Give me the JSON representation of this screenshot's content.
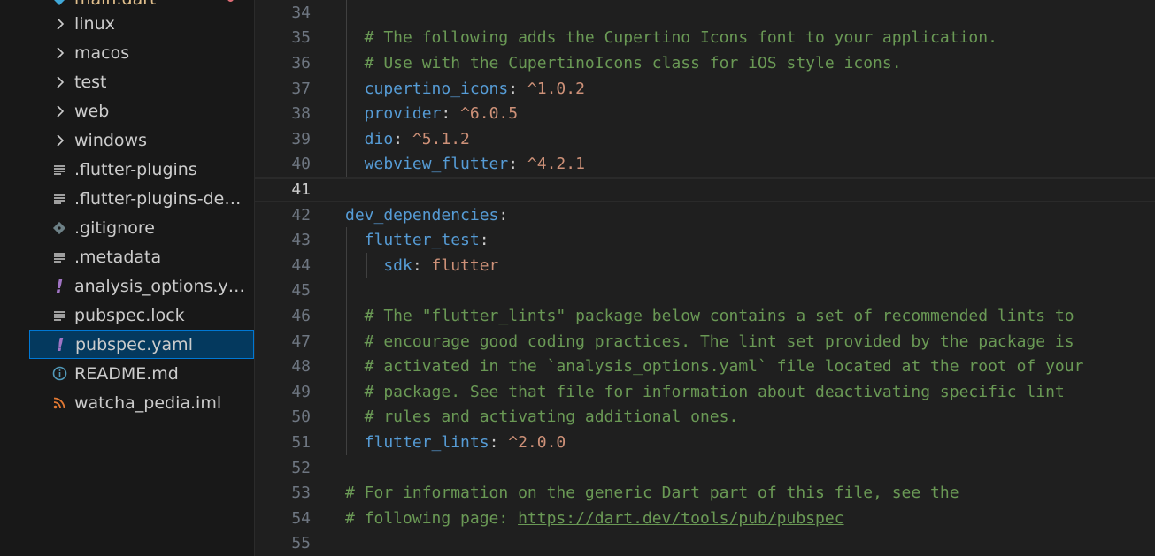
{
  "explorer": {
    "partial_top_label": "main.dart",
    "items": [
      {
        "label": "linux",
        "kind": "folder",
        "icon": "chevron-right-icon"
      },
      {
        "label": "macos",
        "kind": "folder",
        "icon": "chevron-right-icon"
      },
      {
        "label": "test",
        "kind": "folder",
        "icon": "chevron-right-icon"
      },
      {
        "label": "web",
        "kind": "folder",
        "icon": "chevron-right-icon"
      },
      {
        "label": "windows",
        "kind": "folder",
        "icon": "chevron-right-icon"
      },
      {
        "label": ".flutter-plugins",
        "kind": "file",
        "icon": "lines-file-icon"
      },
      {
        "label": ".flutter-plugins-depe...",
        "kind": "file",
        "icon": "lines-file-icon"
      },
      {
        "label": ".gitignore",
        "kind": "file",
        "icon": "git-diamond-icon"
      },
      {
        "label": ".metadata",
        "kind": "file",
        "icon": "lines-file-icon"
      },
      {
        "label": "analysis_options.yaml",
        "kind": "file",
        "icon": "yaml-exclamation-icon"
      },
      {
        "label": "pubspec.lock",
        "kind": "file",
        "icon": "lines-file-icon"
      },
      {
        "label": "pubspec.yaml",
        "kind": "file",
        "icon": "yaml-exclamation-icon",
        "selected": true
      },
      {
        "label": "README.md",
        "kind": "file",
        "icon": "info-circle-icon"
      },
      {
        "label": "watcha_pedia.iml",
        "kind": "file",
        "icon": "rss-icon"
      }
    ]
  },
  "colors": {
    "comment": "#6a9955",
    "key": "#569cd6",
    "value": "#ce9178",
    "yaml_icon": "#a074c4",
    "rss_icon": "#e37933",
    "info_icon": "#519aba",
    "selected_bg": "#04395e",
    "selected_border": "#0078d4"
  },
  "editor": {
    "current_line": 41,
    "lines": [
      {
        "n": "34",
        "parts": []
      },
      {
        "n": "35",
        "parts": [
          {
            "t": "  # The following adds the Cupertino Icons font to your application.",
            "c": "comment"
          }
        ]
      },
      {
        "n": "36",
        "parts": [
          {
            "t": "  # Use with the CupertinoIcons class for iOS style icons.",
            "c": "comment"
          }
        ]
      },
      {
        "n": "37",
        "parts": [
          {
            "t": "  cupertino_icons",
            "c": "key"
          },
          {
            "t": ": ",
            "c": "punct"
          },
          {
            "t": "^1.0.2",
            "c": "val"
          }
        ]
      },
      {
        "n": "38",
        "parts": [
          {
            "t": "  provider",
            "c": "key"
          },
          {
            "t": ": ",
            "c": "punct"
          },
          {
            "t": "^6.0.5",
            "c": "val"
          }
        ]
      },
      {
        "n": "39",
        "parts": [
          {
            "t": "  dio",
            "c": "key"
          },
          {
            "t": ": ",
            "c": "punct"
          },
          {
            "t": "^5.1.2",
            "c": "val"
          }
        ]
      },
      {
        "n": "40",
        "parts": [
          {
            "t": "  webview_flutter",
            "c": "key"
          },
          {
            "t": ": ",
            "c": "punct"
          },
          {
            "t": "^4.2.1",
            "c": "val"
          }
        ]
      },
      {
        "n": "41",
        "parts": []
      },
      {
        "n": "42",
        "parts": [
          {
            "t": "dev_dependencies",
            "c": "key"
          },
          {
            "t": ":",
            "c": "punct"
          }
        ]
      },
      {
        "n": "43",
        "parts": [
          {
            "t": "  flutter_test",
            "c": "key"
          },
          {
            "t": ":",
            "c": "punct"
          }
        ]
      },
      {
        "n": "44",
        "parts": [
          {
            "t": "    sdk",
            "c": "key"
          },
          {
            "t": ": ",
            "c": "punct"
          },
          {
            "t": "flutter",
            "c": "val"
          }
        ]
      },
      {
        "n": "45",
        "parts": []
      },
      {
        "n": "46",
        "parts": [
          {
            "t": "  # The \"flutter_lints\" package below contains a set of recommended lints to",
            "c": "comment"
          }
        ]
      },
      {
        "n": "47",
        "parts": [
          {
            "t": "  # encourage good coding practices. The lint set provided by the package is",
            "c": "comment"
          }
        ]
      },
      {
        "n": "48",
        "parts": [
          {
            "t": "  # activated in the `analysis_options.yaml` file located at the root of your",
            "c": "comment"
          }
        ]
      },
      {
        "n": "49",
        "parts": [
          {
            "t": "  # package. See that file for information about deactivating specific lint",
            "c": "comment"
          }
        ]
      },
      {
        "n": "50",
        "parts": [
          {
            "t": "  # rules and activating additional ones.",
            "c": "comment"
          }
        ]
      },
      {
        "n": "51",
        "parts": [
          {
            "t": "  flutter_lints",
            "c": "key"
          },
          {
            "t": ": ",
            "c": "punct"
          },
          {
            "t": "^2.0.0",
            "c": "val"
          }
        ]
      },
      {
        "n": "52",
        "parts": []
      },
      {
        "n": "53",
        "parts": [
          {
            "t": "# For information on the generic Dart part of this file, see the",
            "c": "comment"
          }
        ]
      },
      {
        "n": "54",
        "parts": [
          {
            "t": "# following page: ",
            "c": "comment"
          },
          {
            "t": "https://dart.dev/tools/pub/pubspec",
            "c": "link"
          }
        ]
      },
      {
        "n": "55",
        "parts": []
      }
    ]
  }
}
